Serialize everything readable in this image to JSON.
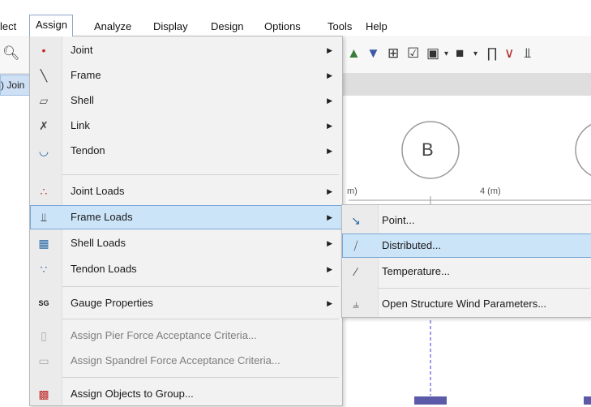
{
  "menubar": {
    "items": [
      "lect",
      "Assign",
      "Analyze",
      "Display",
      "Design",
      "Options",
      "Tools",
      "Help"
    ]
  },
  "tab": {
    "label": ") Join"
  },
  "canvas": {
    "grid_b": "B",
    "dim_left": "m)",
    "dim_right": "4 (m)"
  },
  "assign_menu": {
    "items": [
      {
        "label": "Joint",
        "icon": "joint-icon"
      },
      {
        "label": "Frame",
        "icon": "frame-icon"
      },
      {
        "label": "Shell",
        "icon": "shell-icon"
      },
      {
        "label": "Link",
        "icon": "link-icon"
      },
      {
        "label": "Tendon",
        "icon": "tendon-icon"
      },
      {
        "label": "Joint Loads",
        "icon": "joint-loads-icon"
      },
      {
        "label": "Frame Loads",
        "icon": "frame-loads-icon"
      },
      {
        "label": "Shell Loads",
        "icon": "shell-loads-icon"
      },
      {
        "label": "Tendon Loads",
        "icon": "tendon-loads-icon"
      },
      {
        "label": "Gauge Properties",
        "icon": "gauge-icon",
        "icon_text": "SG"
      },
      {
        "label": "Assign Pier Force Acceptance Criteria...",
        "icon": "pier-icon"
      },
      {
        "label": "Assign Spandrel Force Acceptance Criteria...",
        "icon": "spandrel-icon"
      },
      {
        "label": "Assign Objects to Group...",
        "icon": "group-icon"
      }
    ]
  },
  "frame_loads_submenu": {
    "items": [
      {
        "label": "Point...",
        "icon": "point-load-icon"
      },
      {
        "label": "Distributed...",
        "icon": "distributed-load-icon"
      },
      {
        "label": "Temperature...",
        "icon": "temperature-icon"
      },
      {
        "label": "Open Structure Wind Parameters...",
        "icon": "wind-icon"
      }
    ]
  },
  "colors": {
    "highlight": "#cce4f8",
    "highlight_border": "#7aa7d6",
    "menu_bg": "#f2f2f2",
    "gridline": "#3a3ad0",
    "bubble": "#9a9a9a"
  }
}
